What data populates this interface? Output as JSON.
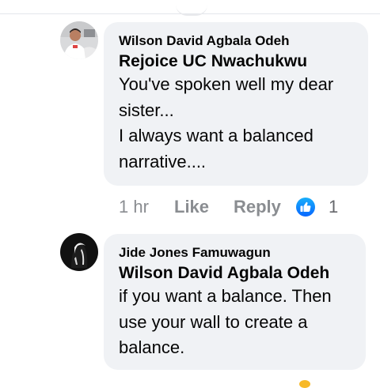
{
  "comments": [
    {
      "author": "Wilson David Agbala Odeh",
      "mention": "Rejoice UC Nwachukwu",
      "lines": [
        "You've spoken well my dear",
        "sister...",
        "I always want a balanced",
        "narrative...."
      ],
      "actions": {
        "time": "1 hr",
        "like": "Like",
        "reply": "Reply",
        "reaction_count": "1",
        "reaction_icon": "thumbs-up-icon"
      }
    },
    {
      "author": "Jide Jones Famuwagun",
      "mention": "Wilson David Agbala Odeh",
      "lines": [
        "if you want a balance. Then",
        "use your wall to create a",
        "balance."
      ]
    }
  ],
  "colors": {
    "bubble_bg": "#f0f2f5",
    "like_blue": "#1877f2",
    "meta_gray": "#8a8d91",
    "text": "#050505"
  }
}
